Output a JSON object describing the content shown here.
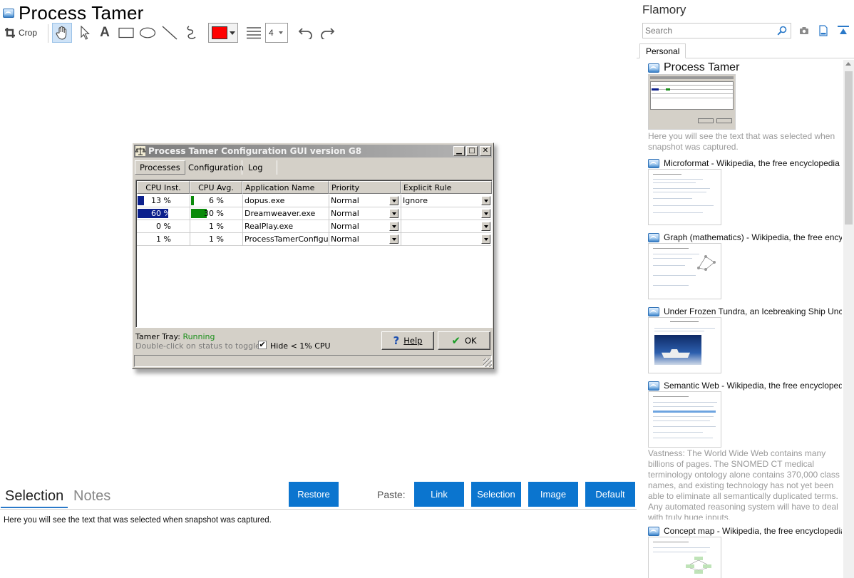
{
  "main": {
    "title": "Process Tamer",
    "toolbar": {
      "crop_label": "Crop",
      "line_width": "4"
    },
    "colors": {
      "accent": "#0b75cf",
      "stroke_color": "#ff0000"
    }
  },
  "dialog": {
    "title": "Process Tamer Configuration GUI version G8",
    "tabs": [
      "Processes",
      "Configuration",
      "Log"
    ],
    "columns": [
      "CPU Inst.",
      "CPU Avg.",
      "Application Name",
      "Priority",
      "Explicit Rule"
    ],
    "rows": [
      {
        "cpu_inst": "13 %",
        "cpu_avg": "6 %",
        "inst_fraction": 0.13,
        "avg_fraction": 0.06,
        "app": "dopus.exe",
        "priority": "Normal",
        "rule": "Ignore"
      },
      {
        "cpu_inst": "60 %",
        "cpu_avg": "30 %",
        "inst_fraction": 0.6,
        "avg_fraction": 0.3,
        "app": "Dreamweaver.exe",
        "priority": "Normal",
        "rule": ""
      },
      {
        "cpu_inst": "0 %",
        "cpu_avg": "1 %",
        "inst_fraction": 0.0,
        "avg_fraction": 0.01,
        "app": "RealPlay.exe",
        "priority": "Normal",
        "rule": ""
      },
      {
        "cpu_inst": "1 %",
        "cpu_avg": "1 %",
        "inst_fraction": 0.01,
        "avg_fraction": 0.01,
        "app": "ProcessTamerConfigurat",
        "priority": "Normal",
        "rule": ""
      }
    ],
    "tray_label": "Tamer Tray:",
    "tray_status": "Running",
    "tray_hint": "Double-click on status to toggle.",
    "hide_label": "Hide < 1% CPU",
    "help_button": "Help",
    "ok_button": "OK"
  },
  "selection_area": {
    "tab_selection": "Selection",
    "tab_notes": "Notes",
    "restore_button": "Restore",
    "paste_label": "Paste:",
    "paste_link": "Link",
    "paste_selection": "Selection",
    "paste_image": "Image",
    "paste_default": "Default",
    "selected_text": "Here you will see the text that was selected when snapshot was captured."
  },
  "panel": {
    "title": "Flamory",
    "search_placeholder": "Search",
    "tab_personal": "Personal",
    "items": [
      {
        "title": "Process Tamer",
        "desc": "Here you will see the text that was selected when snapshot was captured."
      },
      {
        "title": "Microformat - Wikipedia, the free encyclopedia",
        "desc": ""
      },
      {
        "title": "Graph (mathematics) - Wikipedia, the free ency",
        "desc": ""
      },
      {
        "title": "Under Frozen Tundra, an Icebreaking Ship Unco",
        "desc": ""
      },
      {
        "title": "Semantic Web - Wikipedia, the free encycloped",
        "desc": "Vastness: The World Wide Web contains many billions of pages. The SNOMED CT medical terminology ontology alone contains 370,000 class names, and existing technology has not yet been able to eliminate all semantically duplicated terms. Any automated reasoning system will have to deal with truly huge inputs."
      },
      {
        "title": "Concept map - Wikipedia, the free encyclopedia",
        "desc": ""
      }
    ]
  }
}
